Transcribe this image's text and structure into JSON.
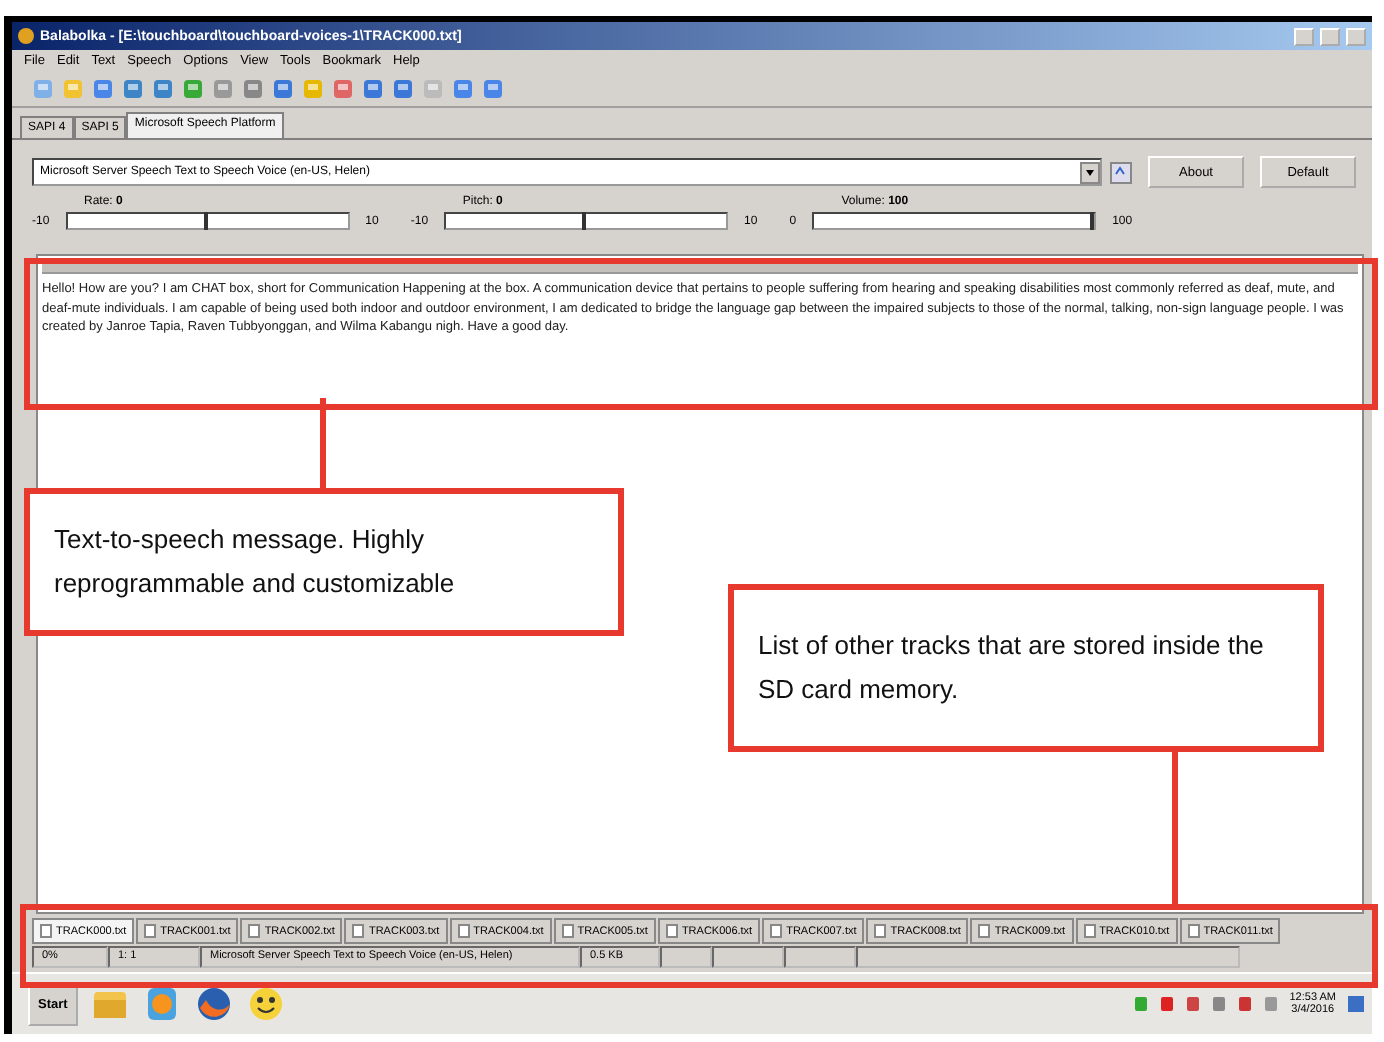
{
  "window": {
    "title": "Balabolka - [E:\\touchboard\\touchboard-voices-1\\TRACK000.txt]"
  },
  "menu": [
    "File",
    "Edit",
    "Text",
    "Speech",
    "Options",
    "View",
    "Tools",
    "Bookmark",
    "Help"
  ],
  "engine_tabs": [
    {
      "label": "SAPI 4",
      "selected": false
    },
    {
      "label": "SAPI 5",
      "selected": false
    },
    {
      "label": "Microsoft Speech Platform",
      "selected": true
    }
  ],
  "voice": {
    "value": "Microsoft Server Speech Text to Speech Voice (en-US, Helen)"
  },
  "buttons": [
    "About",
    "Default"
  ],
  "sliders": [
    {
      "label": "Rate:",
      "reading": "0",
      "min": "-10",
      "max": "10",
      "level": 0.5
    },
    {
      "label": "Pitch:",
      "reading": "0",
      "min": "-10",
      "max": "10",
      "level": 0.5
    },
    {
      "label": "Volume:",
      "reading": "100",
      "min": "0",
      "max": "100",
      "level": 1
    }
  ],
  "text": "Hello! How are you? I am CHAT box, short for Communication Happening at the box. A communication device that pertains to people suffering from hearing and speaking disabilities most commonly referred as deaf, mute, and deaf-mute individuals. I am capable of being used both indoor and outdoor environment, I am dedicated to bridge the language gap between the impaired subjects to those of the normal, talking, non-sign language people. I was created by Janroe Tapia, Raven Tubbyonggan, and Wilma Kabangu nigh. Have a good day.",
  "annotations": [
    {
      "text": "Text-to-speech message. Highly reprogrammable and customizable"
    },
    {
      "text": "List of other tracks that are stored inside the SD card memory."
    }
  ],
  "file_tabs": [
    {
      "label": "TRACK000.txt",
      "selected": true
    },
    {
      "label": "TRACK001.txt",
      "selected": false
    },
    {
      "label": "TRACK002.txt",
      "selected": false
    },
    {
      "label": "TRACK003.txt",
      "selected": false
    },
    {
      "label": "TRACK004.txt",
      "selected": false
    },
    {
      "label": "TRACK005.txt",
      "selected": false
    },
    {
      "label": "TRACK006.txt",
      "selected": false
    },
    {
      "label": "TRACK007.txt",
      "selected": false
    },
    {
      "label": "TRACK008.txt",
      "selected": false
    },
    {
      "label": "TRACK009.txt",
      "selected": false
    },
    {
      "label": "TRACK010.txt",
      "selected": false
    },
    {
      "label": "TRACK011.txt",
      "selected": false
    }
  ],
  "status_bar": [
    "0%",
    "1:  1",
    "Microsoft Server Speech Text to Speech Voice (en-US, Helen)",
    "0.5 KB"
  ],
  "taskbar": {
    "start": "Start",
    "time": "12:53 AM",
    "date": "3/4/2016"
  }
}
